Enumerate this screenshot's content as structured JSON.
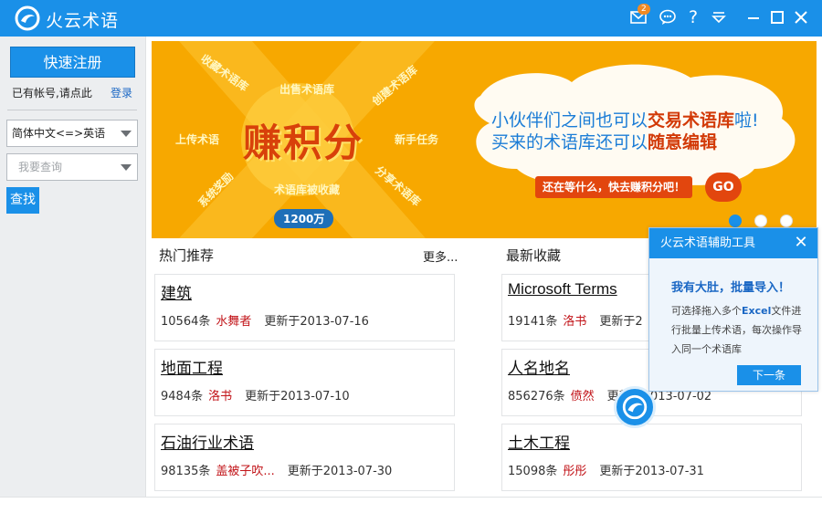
{
  "titlebar": {
    "title": "火云术语",
    "mail_badge": "2",
    "icons": [
      "mail-icon",
      "chat-icon",
      "help-icon",
      "dropdown-menu-icon",
      "minimize-icon",
      "maximize-icon",
      "close-icon"
    ]
  },
  "sidebar": {
    "register_label": "快速注册",
    "has_account_text": "已有帐号,请点此",
    "login_label": "登录",
    "language_select": "简体中文<=>英语",
    "search_placeholder": "我要查询",
    "find_label": "查找"
  },
  "banner": {
    "main_text": "赚积分",
    "labels": [
      "收藏术语库",
      "出售术语库",
      "创建术语库",
      "上传术语",
      "新手任务",
      "系统奖励",
      "术语库被收藏",
      "分享术语库"
    ],
    "cloud_line1_prefix": "小伙伴们之间也可以",
    "cloud_line1_highlight": "交易术语库",
    "cloud_line1_suffix": "啦!",
    "cloud_line2_prefix": "买来的术语库还可以",
    "cloud_line2_highlight": "随意编辑",
    "cta_text": "还在等什么，快去赚积分吧！",
    "go_text": "GO",
    "count_tag": "1200万",
    "accent_color": "#f7a800"
  },
  "hot": {
    "title": "热门推荐",
    "more_label": "更多...",
    "items": [
      {
        "name": "建筑",
        "count": "10564条",
        "user": "水舞者",
        "updated": "更新于2013-07-16"
      },
      {
        "name": "地面工程",
        "count": "9484条",
        "user": "洛书",
        "updated": "更新于2013-07-10"
      },
      {
        "name": "石油行业术语",
        "count": "98135条",
        "user": "盖被子吹...",
        "updated": "更新于2013-07-30"
      }
    ]
  },
  "latest": {
    "title": "最新收藏",
    "items": [
      {
        "name": "Microsoft Terms",
        "count": "19141条",
        "user": "洛书",
        "updated": "更新于2"
      },
      {
        "name": "人名地名",
        "count": "856276条",
        "user": "偾然",
        "updated": "更新于2013-07-02"
      },
      {
        "name": "土木工程",
        "count": "15098条",
        "user": "彤彤",
        "updated": "更新于2013-07-31"
      }
    ]
  },
  "popup": {
    "title": "火云术语辅助工具",
    "heading": "我有大肚，批量导入！",
    "body_prefix": "可选择拖入多个",
    "body_highlight": "Excel",
    "body_suffix": "文件进行批量上传术语，每次操作导入同一个术语库",
    "next_label": "下一条"
  }
}
